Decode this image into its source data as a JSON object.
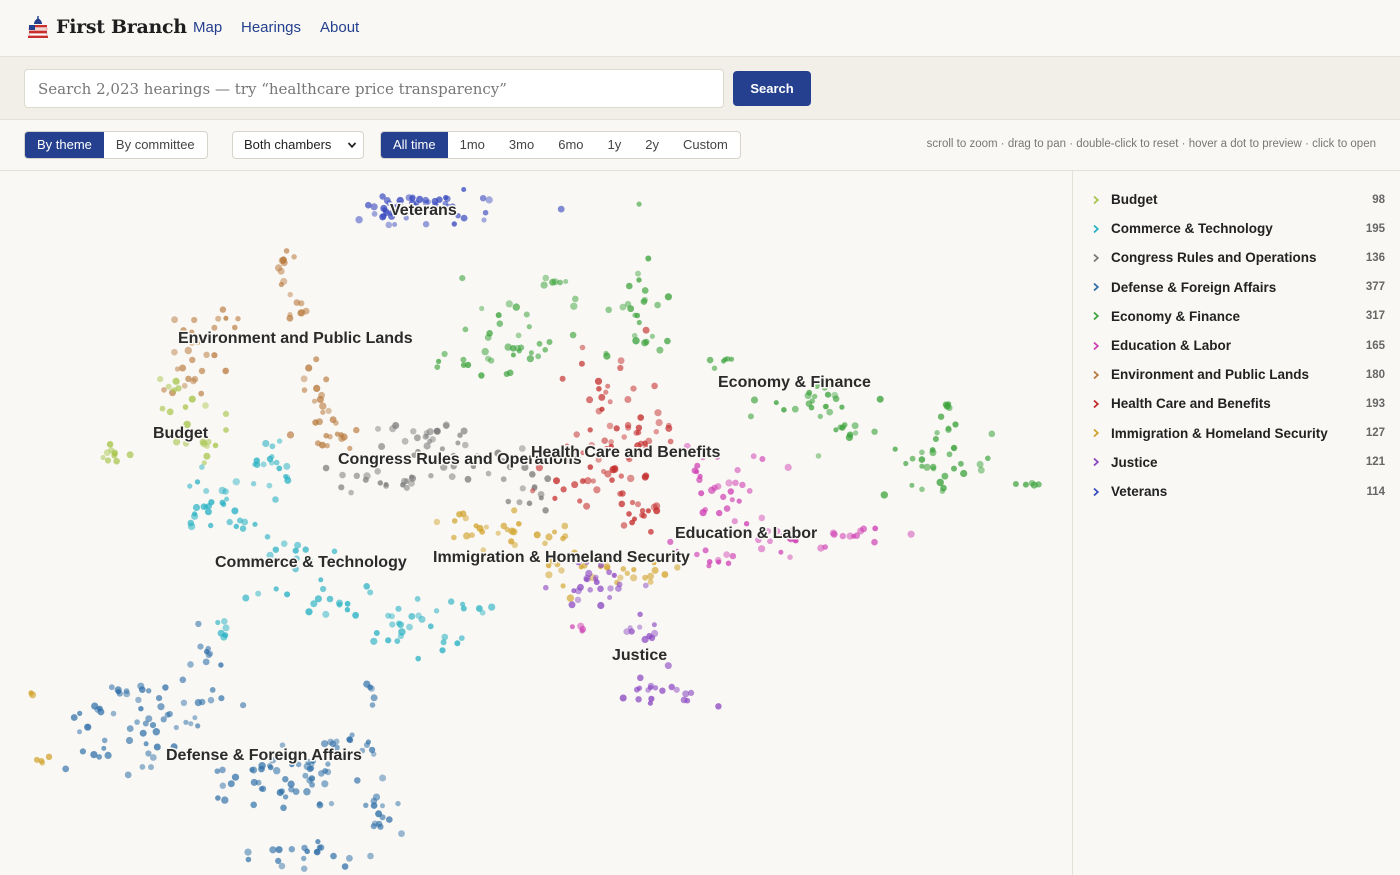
{
  "brand": {
    "name": "First Branch",
    "logo_icon": "flag-capitol-icon"
  },
  "nav": [
    {
      "label": "Map"
    },
    {
      "label": "Hearings"
    },
    {
      "label": "About"
    }
  ],
  "search": {
    "placeholder": "Search 2,023 hearings — try “healthcare price transparency”",
    "value": "",
    "button_label": "Search"
  },
  "view_toggle": {
    "options": [
      "By theme",
      "By committee"
    ],
    "active": "By theme"
  },
  "chamber_select": {
    "selected": "Both chambers"
  },
  "time_range": {
    "options": [
      "All time",
      "1mo",
      "3mo",
      "6mo",
      "1y",
      "2y",
      "Custom"
    ],
    "active": "All time"
  },
  "hint": "scroll to zoom · drag to pan · double-click to reset · hover a dot to preview · click to open",
  "themes": [
    {
      "name": "Budget",
      "count": "98",
      "color": "#a6c44a"
    },
    {
      "name": "Commerce & Technology",
      "count": "195",
      "color": "#29b1c4"
    },
    {
      "name": "Congress Rules and Operations",
      "count": "136",
      "color": "#7a7a7a"
    },
    {
      "name": "Defense & Foreign Affairs",
      "count": "377",
      "color": "#2f6fa8"
    },
    {
      "name": "Economy & Finance",
      "count": "317",
      "color": "#3da33d"
    },
    {
      "name": "Education & Labor",
      "count": "165",
      "color": "#cf3fb3"
    },
    {
      "name": "Environment and Public Lands",
      "count": "180",
      "color": "#b97a3e"
    },
    {
      "name": "Health Care and Benefits",
      "count": "193",
      "color": "#c42b2b"
    },
    {
      "name": "Immigration & Homeland Security",
      "count": "127",
      "color": "#d1a22a"
    },
    {
      "name": "Justice",
      "count": "121",
      "color": "#8a46c2"
    },
    {
      "name": "Veterans",
      "count": "114",
      "color": "#3b4cc0"
    }
  ]
}
